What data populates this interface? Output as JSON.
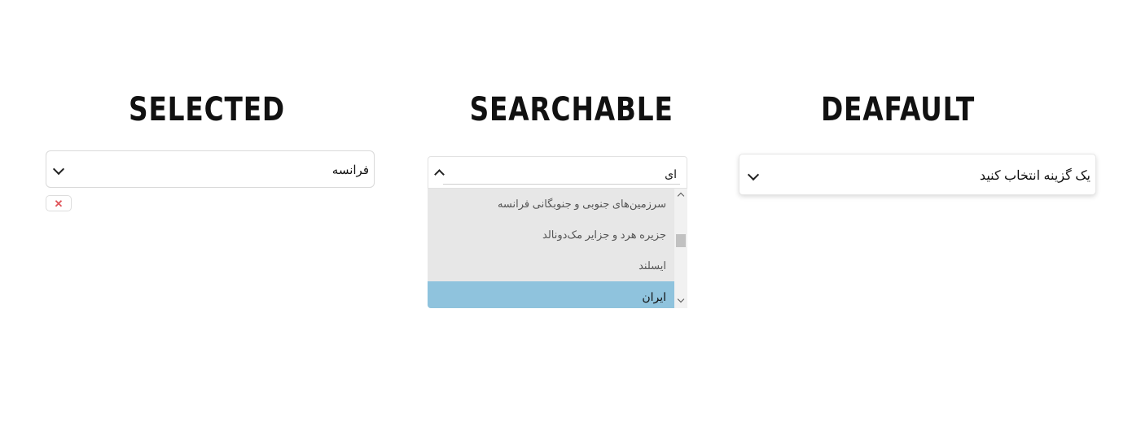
{
  "headings": {
    "selected": "SELECTED",
    "searchable": "SEARCHABLE",
    "default": "DEAFAULT"
  },
  "selected_dropdown": {
    "value": "فرانسه",
    "clear_icon": "✕"
  },
  "searchable_dropdown": {
    "query": "ای",
    "options": [
      "سرزمین‌های جنوبی و جنوبگانی فرانسه",
      "جزیره هرد و جزایر مک‌دونالد",
      "ایسلند",
      "ایران"
    ],
    "active_option": "ایران"
  },
  "default_dropdown": {
    "placeholder": "یک گزینه انتخاب کنید"
  },
  "colors": {
    "active_option_bg": "#8fc3dd",
    "list_bg": "#e7e7e7",
    "clear_icon": "#e0555a"
  },
  "icons": {
    "dropdown": "chevron-down-icon",
    "dropdown_open": "chevron-up-icon",
    "clear": "close-icon"
  }
}
